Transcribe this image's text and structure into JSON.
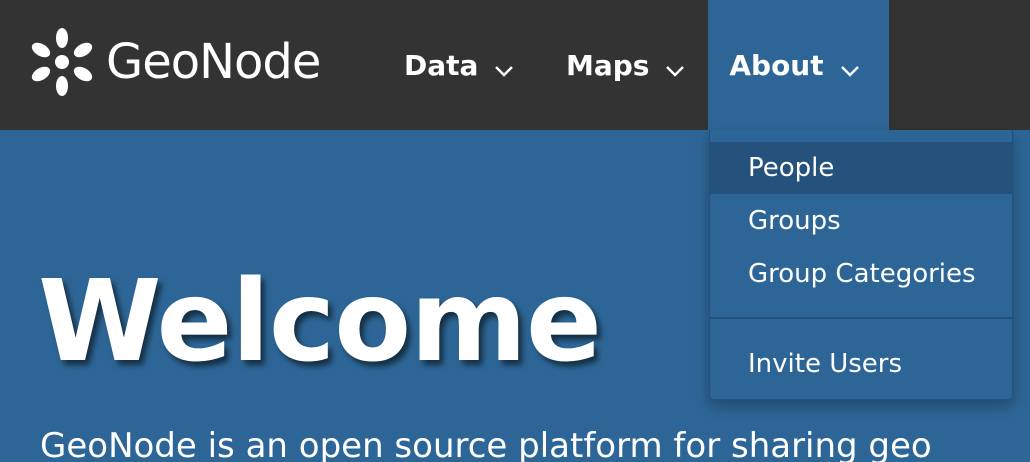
{
  "brand": {
    "name": "GeoNode",
    "logo_icon": "geonode-flower-icon"
  },
  "nav": {
    "items": [
      {
        "label": "Data",
        "icon": "chevron-down-icon"
      },
      {
        "label": "Maps",
        "icon": "chevron-down-icon"
      },
      {
        "label": "About",
        "icon": "chevron-down-icon",
        "active": true
      }
    ]
  },
  "dropdown": {
    "items": [
      {
        "label": "People",
        "highlighted": true
      },
      {
        "label": "Groups"
      },
      {
        "label": "Group Categories"
      },
      {
        "label": "Invite Users"
      }
    ]
  },
  "hero": {
    "title": "Welcome",
    "subtitle": "GeoNode is an open source platform for sharing geo"
  },
  "colors": {
    "navbar_bg": "#333333",
    "primary": "#2d6696",
    "dropdown_highlight": "#24527c",
    "text": "#ffffff"
  }
}
